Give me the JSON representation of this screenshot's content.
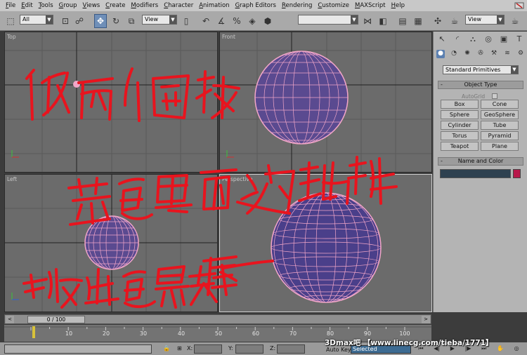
{
  "menu": [
    "File",
    "Edit",
    "Tools",
    "Group",
    "Views",
    "Create",
    "Modifiers",
    "Character",
    "Animation",
    "Graph Editors",
    "Rendering",
    "Customize",
    "MAXScript",
    "Help"
  ],
  "toolbar": {
    "selection_filter": "All",
    "ref_coord": "View",
    "view_combo_right": "View"
  },
  "viewports": {
    "top": "Top",
    "front": "Front",
    "left": "Left",
    "perspective": "Perspective"
  },
  "command_panel": {
    "category": "Standard Primitives",
    "object_type_title": "Object Type",
    "autogrid": "AutoGrid",
    "buttons": [
      "Box",
      "Cone",
      "Sphere",
      "GeoSphere",
      "Cylinder",
      "Tube",
      "Torus",
      "Pyramid",
      "Teapot",
      "Plane"
    ],
    "name_color_title": "Name and Color"
  },
  "timeline": {
    "frame_display": "0 / 100",
    "ticks": [
      "10",
      "20",
      "30",
      "40",
      "50",
      "60",
      "70",
      "80",
      "90",
      "100"
    ]
  },
  "status": {
    "x_label": "X:",
    "y_label": "Y:",
    "z_label": "Z:",
    "auto_key": "Auto Key",
    "selected": "Selected"
  },
  "watermark": "3Dmax吧 【www.linecg.com/tieba/1771】",
  "colors": {
    "annotation": "#e8141e",
    "sphere_outer": "#f0a0c8",
    "sphere_inner": "#3a3aa0",
    "viewport_bg": "#6b6b6b",
    "active_tool": "#6f8fb8"
  }
}
